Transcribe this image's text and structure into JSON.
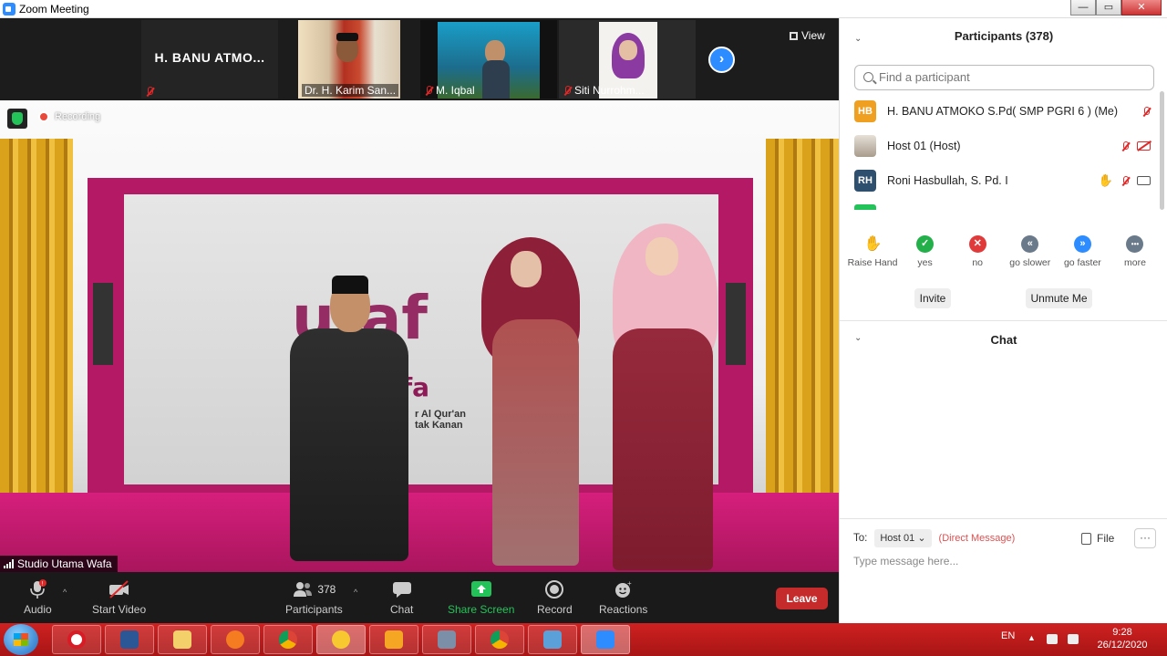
{
  "window": {
    "title": "Zoom Meeting",
    "buttons": [
      "—",
      "▭",
      "✕"
    ]
  },
  "strip": {
    "tiles": [
      {
        "name": "H. BANU ATMO...",
        "big_label": "H. BANU ATMO...",
        "muted": true
      },
      {
        "name": "Dr. H. Karim San...",
        "muted": false
      },
      {
        "name": "M. Iqbal",
        "muted": true
      },
      {
        "name": "Siti Nurrohm...",
        "muted": true
      }
    ],
    "view_label": "View"
  },
  "stage": {
    "recording_label": "Recording",
    "speaker_name": "Studio Utama Wafa",
    "logo_main": "ufaf",
    "logo_sub": "fa",
    "tagline": [
      "r Al Qur'an",
      "tak Kanan"
    ]
  },
  "toolbar": {
    "audio": "Audio",
    "start_video": "Start Video",
    "participants": "Participants",
    "participants_count": "378",
    "chat": "Chat",
    "share_screen": "Share Screen",
    "record": "Record",
    "reactions": "Reactions",
    "leave": "Leave"
  },
  "panel": {
    "participants_title": "Participants (378)",
    "search_placeholder": "Find a participant",
    "participants": [
      {
        "initials": "HB",
        "name": "H. BANU ATMOKO     S.Pd( SMP PGRI 6 ) (Me)",
        "color": "#f0a020"
      },
      {
        "initials": "",
        "name": "Host 01 (Host)",
        "color": "#c8c0b8"
      },
      {
        "initials": "RH",
        "name": "Roni Hasbullah, S. Pd. I",
        "color": "#2f4f6f"
      }
    ],
    "reactions": [
      {
        "label": "Raise Hand",
        "symbol": "✋",
        "color": "#2d8cff"
      },
      {
        "label": "yes",
        "symbol": "✓",
        "color": "#23b04a"
      },
      {
        "label": "no",
        "symbol": "✕",
        "color": "#e03a3a"
      },
      {
        "label": "go slower",
        "symbol": "«",
        "color": "#6a7a8a"
      },
      {
        "label": "go faster",
        "symbol": "»",
        "color": "#2d8cff"
      },
      {
        "label": "more",
        "symbol": "•••",
        "color": "#6a7a8a"
      }
    ],
    "invite": "Invite",
    "unmute_me": "Unmute Me",
    "chat_title": "Chat",
    "to_label": "To:",
    "to_value": "Host 01",
    "direct_message": "(Direct Message)",
    "file": "File",
    "message_placeholder": "Type message here..."
  },
  "taskbar": {
    "language": "EN",
    "time": "9:28",
    "date": "26/12/2020"
  }
}
